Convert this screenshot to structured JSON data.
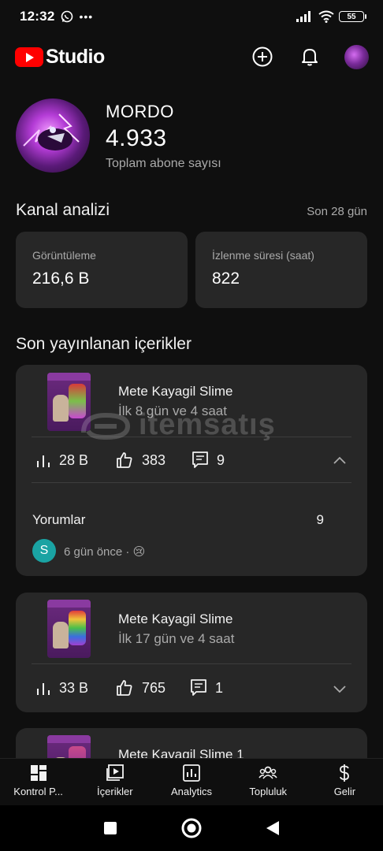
{
  "status_bar": {
    "time": "12:32",
    "dots": "•••",
    "battery": "55"
  },
  "header": {
    "brand": "Studio"
  },
  "channel": {
    "name": "MORDO",
    "subscribers": "4.933",
    "subscribers_label": "Toplam abone sayısı"
  },
  "analytics": {
    "title": "Kanal analizi",
    "period": "Son 28 gün",
    "cards": [
      {
        "label": "Görüntüleme",
        "value": "216,6 B"
      },
      {
        "label": "İzlenme süresi (saat)",
        "value": "822"
      }
    ]
  },
  "recent": {
    "title": "Son yayınlanan içerikler",
    "items": [
      {
        "title": "Mete Kayagil Slime",
        "subtitle": "İlk 8 gün ve 4 saat",
        "views": "28 B",
        "likes": "383",
        "comments": "9",
        "expanded": true
      },
      {
        "title": "Mete Kayagil Slime",
        "subtitle": "İlk 17 gün ve 4 saat",
        "views": "33 B",
        "likes": "765",
        "comments": "1",
        "expanded": false
      },
      {
        "title": "Mete Kayagil Slime 1"
      }
    ],
    "comments_section": {
      "label": "Yorumlar",
      "count": "9",
      "avatar_letter": "S",
      "meta": "6 gün önce ·",
      "emoji": "😢"
    }
  },
  "watermark": {
    "text": "itemsatış"
  },
  "bottom_nav": {
    "items": [
      {
        "label": "Kontrol P...",
        "icon": "dashboard-icon"
      },
      {
        "label": "İçerikler",
        "icon": "content-icon"
      },
      {
        "label": "Analytics",
        "icon": "analytics-icon"
      },
      {
        "label": "Topluluk",
        "icon": "community-icon"
      },
      {
        "label": "Gelir",
        "icon": "earn-icon"
      }
    ]
  },
  "colors": {
    "background": "#0f0f0f",
    "card": "#272727",
    "brand_red": "#ff0000",
    "muted_text": "#aaaaaa"
  }
}
